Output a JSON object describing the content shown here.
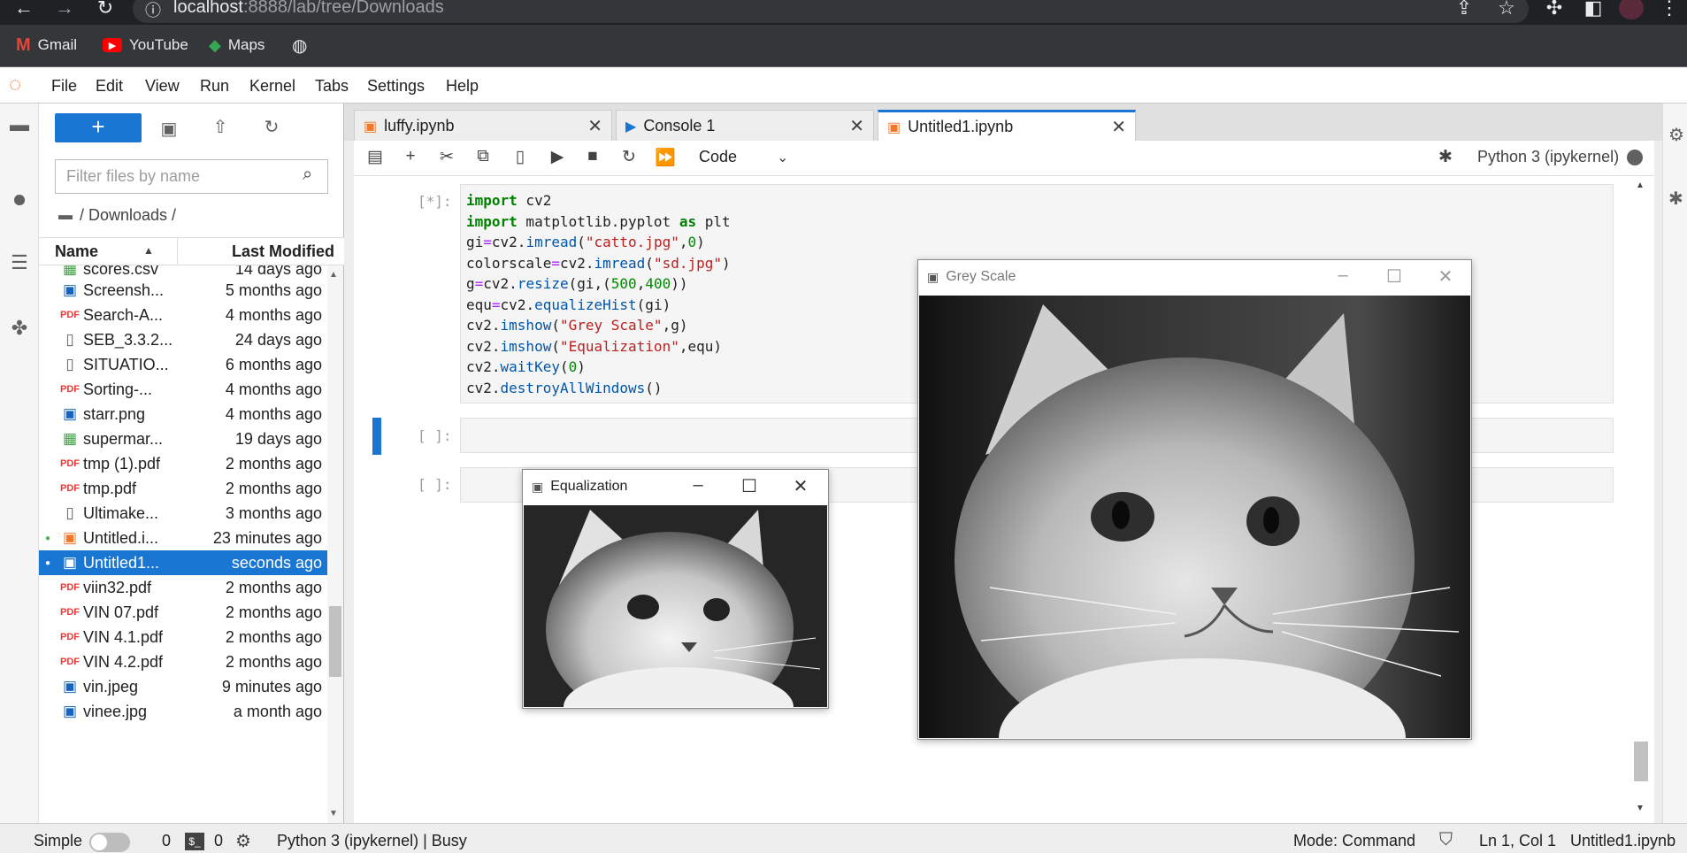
{
  "browser": {
    "url_host": "localhost",
    "url_rest": ":8888/lab/tree/Downloads",
    "bookmarks": [
      "Gmail",
      "YouTube",
      "Maps"
    ]
  },
  "menubar": {
    "items": [
      "File",
      "Edit",
      "View",
      "Run",
      "Kernel",
      "Tabs",
      "Settings",
      "Help"
    ]
  },
  "filebrowser": {
    "new_label": "+",
    "filter_placeholder": "Filter files by name",
    "breadcrumb": "/ Downloads /",
    "col_name": "Name",
    "col_modified": "Last Modified",
    "files": [
      {
        "name": "scores.csv",
        "modified": "14 days ago",
        "icon": "sheet",
        "running": false,
        "selected": false
      },
      {
        "name": "Screensh...",
        "modified": "5 months ago",
        "icon": "image",
        "running": false,
        "selected": false
      },
      {
        "name": "Search-A...",
        "modified": "4 months ago",
        "icon": "pdf",
        "running": false,
        "selected": false
      },
      {
        "name": "SEB_3.3.2...",
        "modified": "24 days ago",
        "icon": "file",
        "running": false,
        "selected": false
      },
      {
        "name": "SITUATIO...",
        "modified": "6 months ago",
        "icon": "file",
        "running": false,
        "selected": false
      },
      {
        "name": "Sorting-...",
        "modified": "4 months ago",
        "icon": "pdf",
        "running": false,
        "selected": false
      },
      {
        "name": "starr.png",
        "modified": "4 months ago",
        "icon": "image",
        "running": false,
        "selected": false
      },
      {
        "name": "supermar...",
        "modified": "19 days ago",
        "icon": "sheet",
        "running": false,
        "selected": false
      },
      {
        "name": "tmp (1).pdf",
        "modified": "2 months ago",
        "icon": "pdf",
        "running": false,
        "selected": false
      },
      {
        "name": "tmp.pdf",
        "modified": "2 months ago",
        "icon": "pdf",
        "running": false,
        "selected": false
      },
      {
        "name": "Ultimake...",
        "modified": "3 months ago",
        "icon": "file",
        "running": false,
        "selected": false
      },
      {
        "name": "Untitled.i...",
        "modified": "23 minutes ago",
        "icon": "notebook",
        "running": true,
        "selected": false
      },
      {
        "name": "Untitled1...",
        "modified": "seconds ago",
        "icon": "notebook",
        "running": true,
        "selected": true
      },
      {
        "name": "viin32.pdf",
        "modified": "2 months ago",
        "icon": "pdf",
        "running": false,
        "selected": false
      },
      {
        "name": "VIN 07.pdf",
        "modified": "2 months ago",
        "icon": "pdf",
        "running": false,
        "selected": false
      },
      {
        "name": "VIN 4.1.pdf",
        "modified": "2 months ago",
        "icon": "pdf",
        "running": false,
        "selected": false
      },
      {
        "name": "VIN 4.2.pdf",
        "modified": "2 months ago",
        "icon": "pdf",
        "running": false,
        "selected": false
      },
      {
        "name": "vin.jpeg",
        "modified": "9 minutes ago",
        "icon": "image",
        "running": false,
        "selected": false
      },
      {
        "name": "vinee.jpg",
        "modified": "a month ago",
        "icon": "image",
        "running": false,
        "selected": false
      }
    ]
  },
  "tabs": [
    {
      "label": "luffy.ipynb",
      "icon": "notebook",
      "active": false
    },
    {
      "label": "Console 1",
      "icon": "console",
      "active": false
    },
    {
      "label": "Untitled1.ipynb",
      "icon": "notebook",
      "active": true
    }
  ],
  "notebook": {
    "cell_type": "Code",
    "kernel": "Python 3 (ipykernel)",
    "cells": [
      {
        "prompt": "[*]:"
      },
      {
        "prompt": "[ ]:"
      },
      {
        "prompt": "[ ]:"
      }
    ]
  },
  "windows": {
    "grey": {
      "title": "Grey Scale"
    },
    "equ": {
      "title": "Equalization"
    }
  },
  "statusbar": {
    "mode_label": "Simple",
    "terminals": "0",
    "kernels": "0",
    "kernel_status": "Python 3 (ipykernel) | Busy",
    "mode": "Mode: Command",
    "position": "Ln 1, Col 1",
    "file": "Untitled1.ipynb"
  },
  "colors": {
    "accent": "#1976d2",
    "notebook_icon": "#f37726",
    "pdf": "#e53935",
    "sheet": "#43a047",
    "image": "#1565c0"
  }
}
